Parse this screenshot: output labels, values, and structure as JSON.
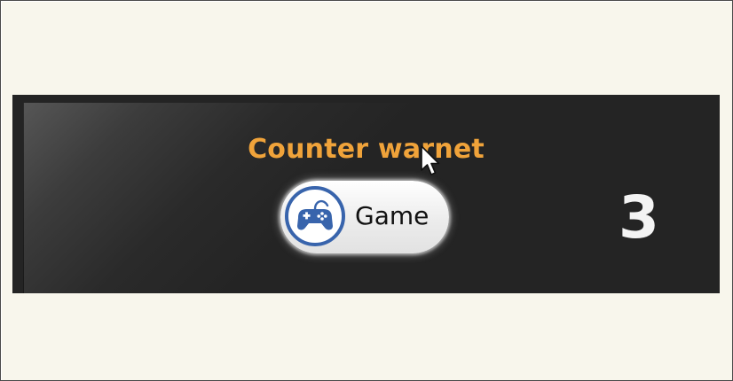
{
  "panel": {
    "title": "Counter warnet",
    "game_button": {
      "label": "Game",
      "icon": "gamepad-icon"
    },
    "counter_value": "3"
  },
  "cursor": {
    "icon": "mouse-pointer-icon"
  },
  "colors": {
    "background": "#f8f6ec",
    "panel": "#242424",
    "title": "#f0a33a",
    "icon_blue": "#3864ac",
    "counter": "#f4f4f4"
  }
}
